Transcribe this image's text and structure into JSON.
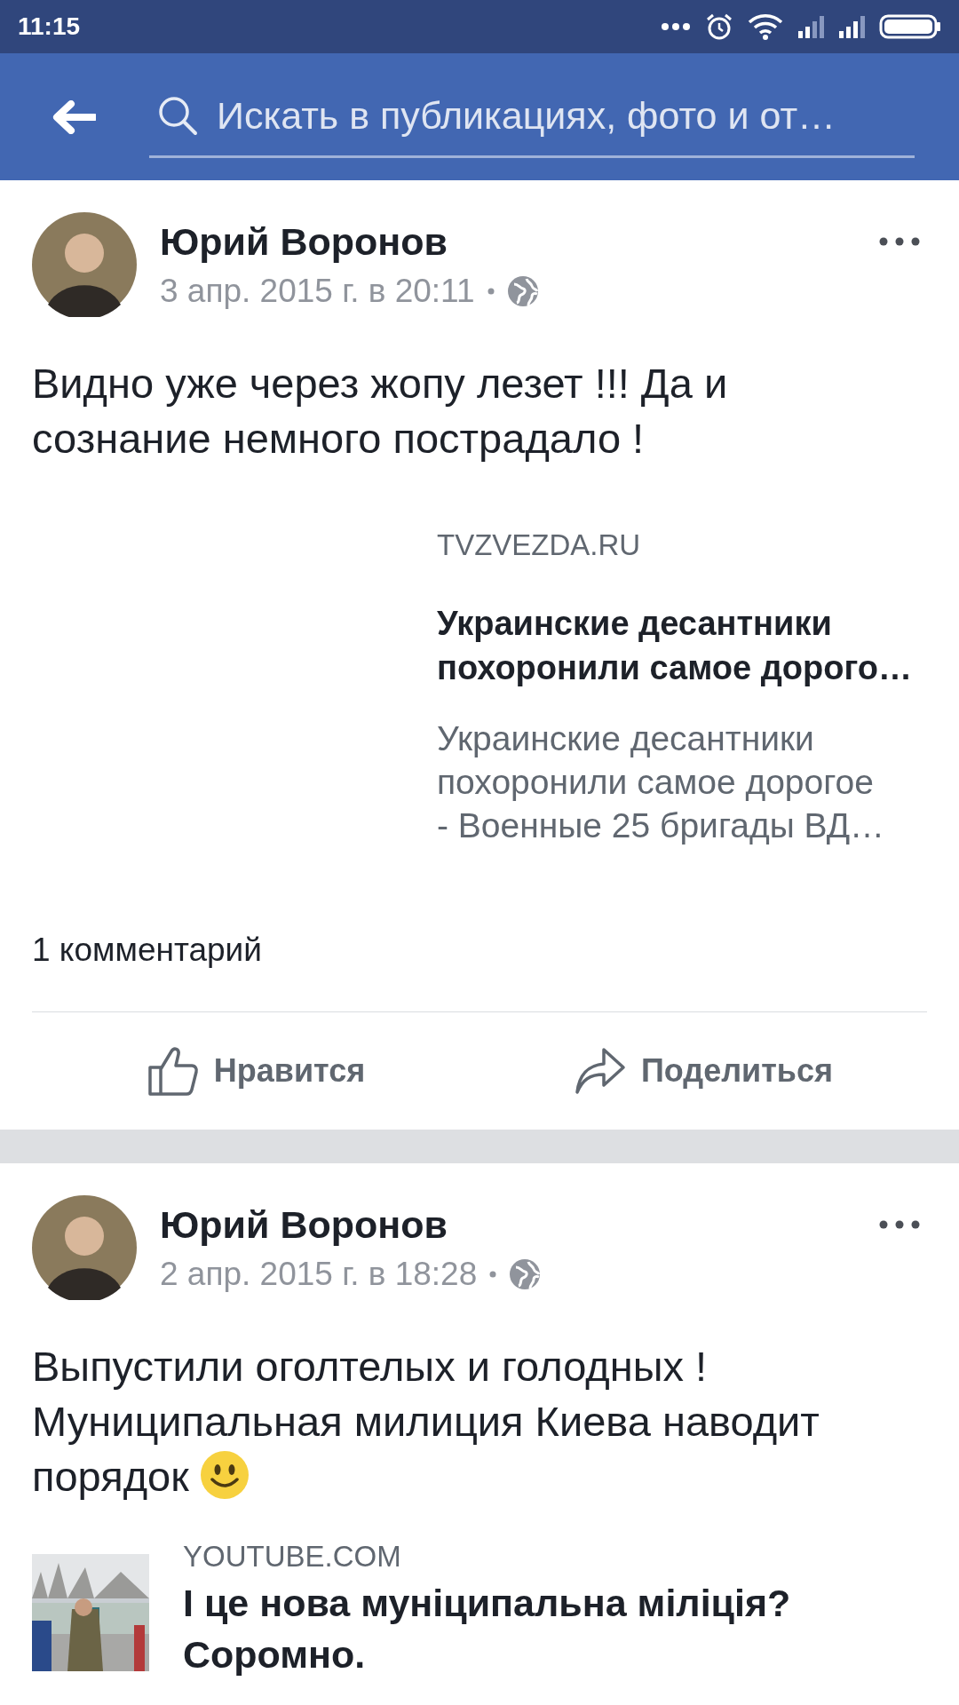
{
  "status_bar": {
    "time": "11:15"
  },
  "search": {
    "placeholder": "Искать в публикациях, фото и от…"
  },
  "posts": [
    {
      "author": "Юрий Воронов",
      "date": "3 апр. 2015 г. в 20:11",
      "text_lines": [
        "Видно уже через жопу лезет !!! Да и",
        "сознание немного пострадало !"
      ],
      "link": {
        "kind": "large",
        "source": "TVZVEZDA.RU",
        "title_lines": [
          "Украинские десантники",
          "похоронили самое дорого…"
        ],
        "description_lines": [
          "Украинские десантники",
          "похоронили самое дорогое",
          "- Военные 25 бригады ВД…"
        ]
      },
      "comments": "1 комментарий",
      "actions": [
        "Нравится",
        "Поделиться"
      ]
    },
    {
      "author": "Юрий Воронов",
      "date": "2 апр. 2015 г. в 18:28",
      "text_lines": [
        "Выпустили оголтелых и голодных !",
        "Муниципальная милиция Киева наводит",
        "порядок"
      ],
      "smiley": true,
      "link": {
        "kind": "compact",
        "source": "YOUTUBE.COM",
        "title_lines": [
          "І це нова муніципальна міліція?",
          "Соромно."
        ]
      }
    }
  ]
}
